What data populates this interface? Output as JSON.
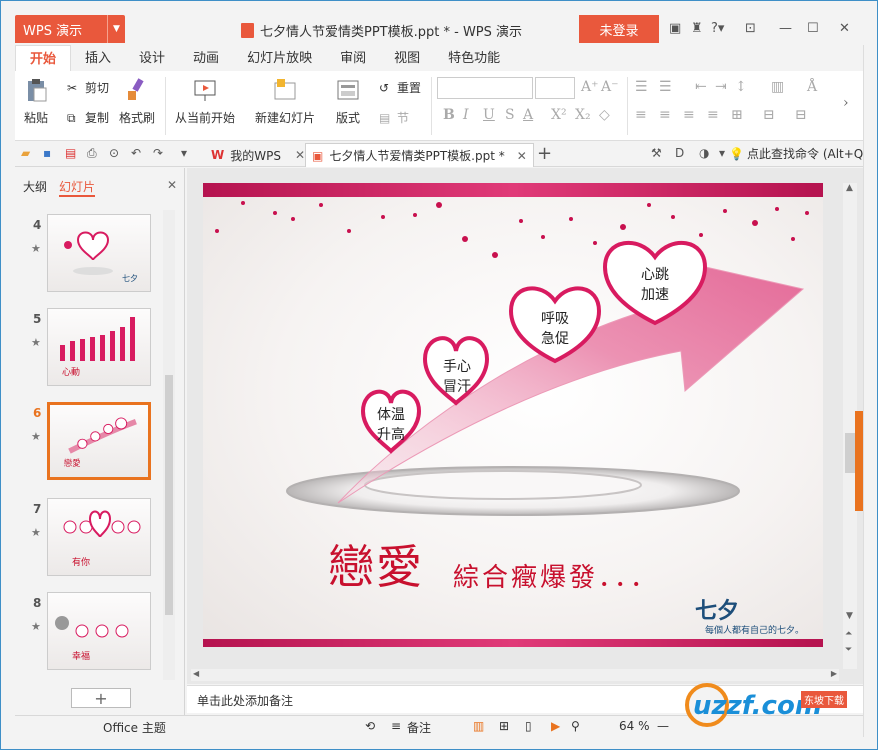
{
  "app": {
    "menu_label": "WPS 演示",
    "login": "未登录",
    "window_title": "七夕情人节爱情类PPT模板.ppt * - WPS 演示"
  },
  "tabs": [
    "开始",
    "插入",
    "设计",
    "动画",
    "幻灯片放映",
    "审阅",
    "视图",
    "特色功能"
  ],
  "ribbon": {
    "paste": "粘贴",
    "cut": "剪切",
    "copy": "复制",
    "format_painter": "格式刷",
    "from_current": "从当前开始",
    "new_slide": "新建幻灯片",
    "layout": "版式",
    "reset": "重置",
    "section": "节"
  },
  "doc_tabs": {
    "mywps": "我的WPS",
    "file": "七夕情人节爱情类PPT模板.ppt *"
  },
  "search_cmd": "点此查找命令 (Alt+Q)",
  "left_panel": {
    "outline": "大纲",
    "slides": "幻灯片",
    "numbers": [
      "4",
      "5",
      "6",
      "7",
      "8"
    ],
    "selected": "6"
  },
  "slide": {
    "hearts": [
      {
        "line1": "体温",
        "line2": "升高"
      },
      {
        "line1": "手心",
        "line2": "冒汗"
      },
      {
        "line1": "呼吸",
        "line2": "急促"
      },
      {
        "line1": "心跳",
        "line2": "加速"
      }
    ],
    "title_big": "戀愛",
    "title_sub": "綜合癥爆發．．．",
    "brand": "七夕",
    "brand_sub": "每個人都有自己的七夕。"
  },
  "notes": "单击此处添加备注",
  "status": {
    "theme": "Office 主题",
    "notes_btn": "备注",
    "zoom": "64 %"
  },
  "watermark": {
    "text": "uzzf.com",
    "badge": "东坡下载"
  },
  "colors": {
    "accent": "#e9583c",
    "heart": "#d81b60"
  }
}
